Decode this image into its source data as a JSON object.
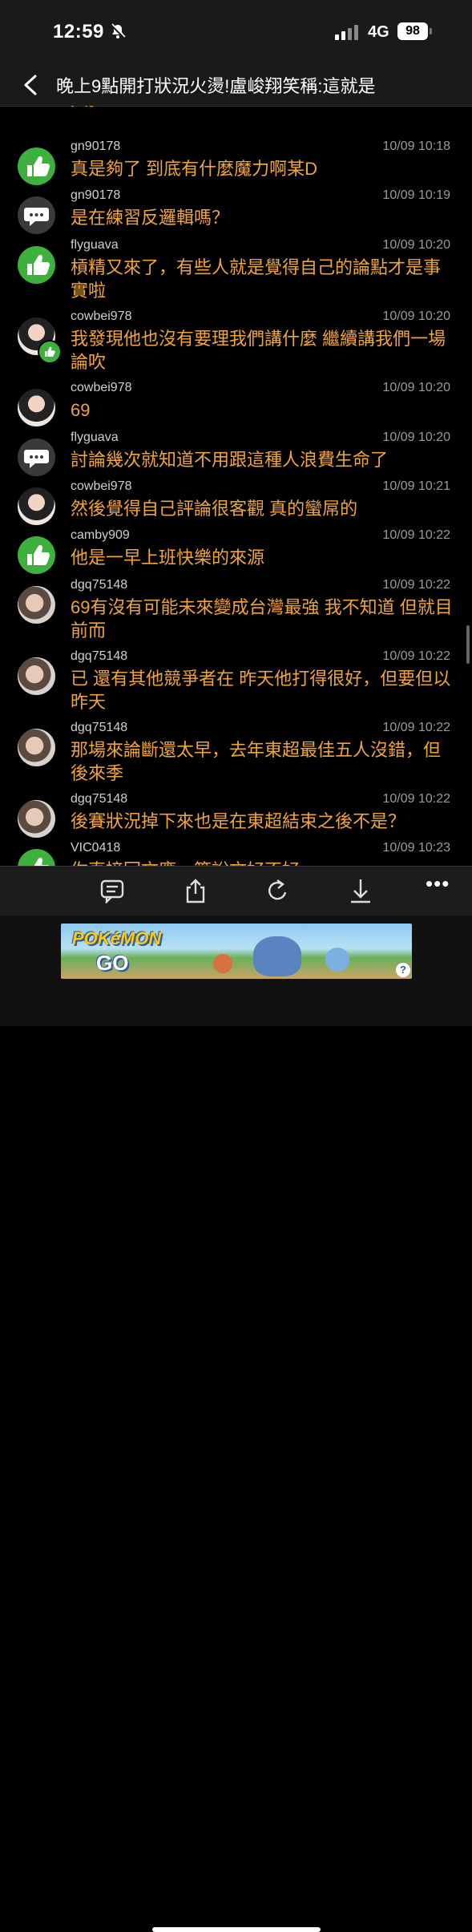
{
  "status_bar": {
    "time": "12:59",
    "network": "4G",
    "battery": "98"
  },
  "header": {
    "title": "晚上9點開打狀況火燙!盧峻翔笑稱:這就是"
  },
  "partial_line": "人。",
  "comments": [
    {
      "user": "gn90178",
      "time": "10/09 10:18",
      "text": "真是夠了 到底有什麼魔力啊某D",
      "avatar": "like-icon"
    },
    {
      "user": "gn90178",
      "time": "10/09 10:19",
      "text": "是在練習反邏輯嗎？",
      "avatar": "chat-icon"
    },
    {
      "user": "flyguava",
      "time": "10/09 10:20",
      "text": "槓精又來了，有些人就是覺得自己的論點才是事實啦",
      "avatar": "like-icon"
    },
    {
      "user": "cowbei978",
      "time": "10/09 10:20",
      "text": "我發現他也沒有要理我們講什麼 繼續講我們一場論吹",
      "avatar": "photo"
    },
    {
      "user": "cowbei978",
      "time": "10/09 10:20",
      "text": "69",
      "avatar": "photo"
    },
    {
      "user": "flyguava",
      "time": "10/09 10:20",
      "text": "討論幾次就知道不用跟這種人浪費生命了",
      "avatar": "chat-icon"
    },
    {
      "user": "cowbei978",
      "time": "10/09 10:21",
      "text": "然後覺得自己評論很客觀 真的蠻屌的",
      "avatar": "photo"
    },
    {
      "user": "camby909",
      "time": "10/09 10:22",
      "text": "他是一早上班快樂的來源",
      "avatar": "like-icon"
    },
    {
      "user": "dgq75148",
      "time": "10/09 10:22",
      "text": "69有沒有可能未來變成台灣最強 我不知道 但就目前而",
      "avatar": "photo2"
    },
    {
      "user": "dgq75148",
      "time": "10/09 10:22",
      "text": "已 還有其他競爭者在 昨天他打得很好，但要但以昨天",
      "avatar": "photo2"
    },
    {
      "user": "dgq75148",
      "time": "10/09 10:22",
      "text": "那場來論斷還太早，去年東超最佳五人沒錯，但後來季",
      "avatar": "photo2"
    },
    {
      "user": "dgq75148",
      "time": "10/09 10:22",
      "text": "後賽狀況掉下來也是在東超結束之後不是？",
      "avatar": "photo2"
    },
    {
      "user": "VIC0418",
      "time": "10/09 10:23",
      "text": "你直接回文應⋯簡說文好不好",
      "avatar": "like-icon"
    }
  ],
  "toolbar": {
    "more": "•••"
  },
  "ad": {
    "logo_text": "POKéMON",
    "logo_sub": "GO",
    "help": "?"
  }
}
